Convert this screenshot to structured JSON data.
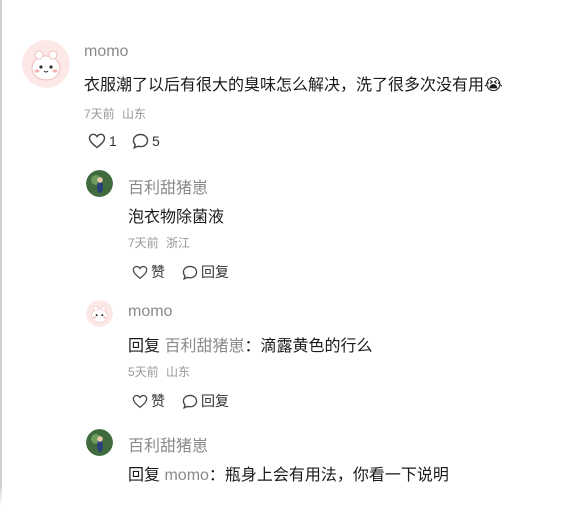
{
  "main_comment": {
    "username": "momo",
    "text": "衣服潮了以后有很大的臭味怎么解决，洗了很多次没有用",
    "emoji": "😭",
    "time": "7天前",
    "location": "山东",
    "like_count": "1",
    "reply_count": "5"
  },
  "replies": [
    {
      "username": "百利甜猪崽",
      "text": "泡衣物除菌液",
      "time": "7天前",
      "location": "浙江",
      "like_label": "赞",
      "reply_label": "回复"
    },
    {
      "username": "momo",
      "reply_prefix": "回复",
      "reply_to": "百利甜猪崽",
      "text": "：滴露黄色的行么",
      "time": "5天前",
      "location": "山东",
      "like_label": "赞",
      "reply_label": "回复"
    },
    {
      "username": "百利甜猪崽",
      "reply_prefix": "回复",
      "reply_to": "momo",
      "text": "：瓶身上会有用法，你看一下说明",
      "time": "",
      "location": ""
    }
  ],
  "colors": {
    "username": "#8a8a8a",
    "body_text": "#1a1a1a",
    "meta": "#999999",
    "momo_avatar_bg": "#fde6e6",
    "pig_avatar_bg": "#3f6b3e"
  },
  "icons": {
    "like": "heart-outline-icon",
    "comment": "speech-bubble-icon"
  }
}
